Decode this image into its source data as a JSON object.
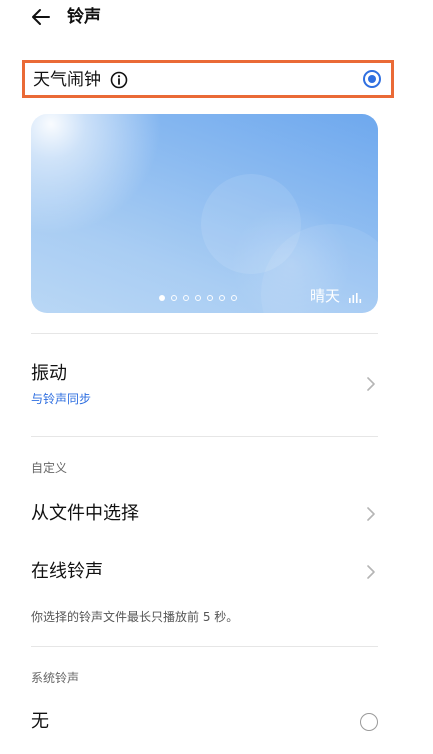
{
  "header": {
    "title": "铃声",
    "back_icon": "back-arrow-icon"
  },
  "weather_alarm": {
    "label": "天气闹钟",
    "selected": true,
    "info_icon": "info-icon"
  },
  "weather_card": {
    "condition": "晴天",
    "pages": 7,
    "active_page": 1
  },
  "vibration": {
    "title": "振动",
    "subtitle": "与铃声同步"
  },
  "custom": {
    "section_label": "自定义",
    "from_file": "从文件中选择",
    "online": "在线铃声",
    "note": "你选择的铃声文件最长只播放前 5 秒。"
  },
  "system": {
    "section_label": "系统铃声",
    "none_label": "无",
    "none_selected": false
  },
  "colors": {
    "accent": "#2f6fe0",
    "highlight_border": "#ea6a36"
  }
}
